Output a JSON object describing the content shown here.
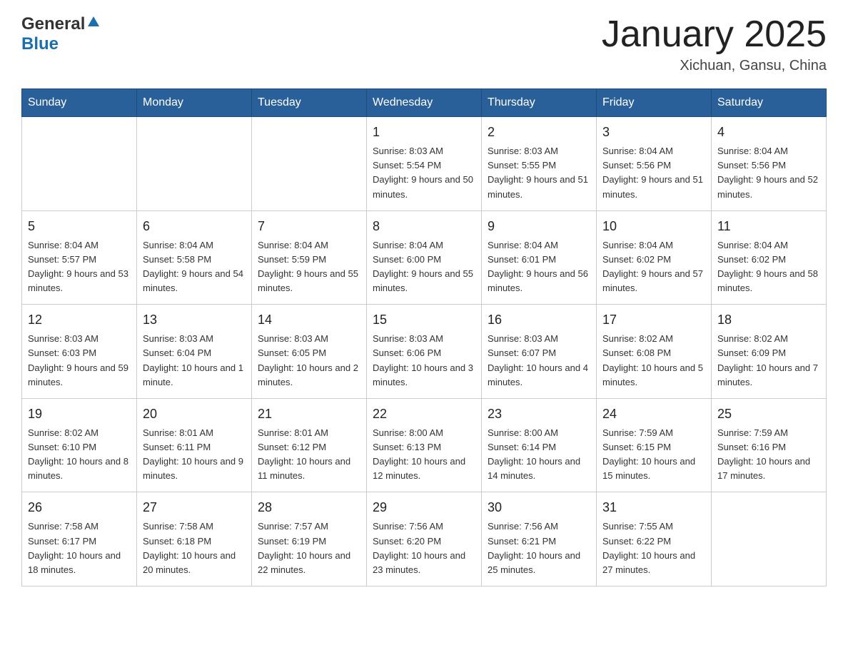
{
  "logo": {
    "general": "General",
    "blue": "Blue"
  },
  "title": {
    "month_year": "January 2025",
    "location": "Xichuan, Gansu, China"
  },
  "headers": [
    "Sunday",
    "Monday",
    "Tuesday",
    "Wednesday",
    "Thursday",
    "Friday",
    "Saturday"
  ],
  "weeks": [
    [
      {
        "day": "",
        "info": ""
      },
      {
        "day": "",
        "info": ""
      },
      {
        "day": "",
        "info": ""
      },
      {
        "day": "1",
        "info": "Sunrise: 8:03 AM\nSunset: 5:54 PM\nDaylight: 9 hours\nand 50 minutes."
      },
      {
        "day": "2",
        "info": "Sunrise: 8:03 AM\nSunset: 5:55 PM\nDaylight: 9 hours\nand 51 minutes."
      },
      {
        "day": "3",
        "info": "Sunrise: 8:04 AM\nSunset: 5:56 PM\nDaylight: 9 hours\nand 51 minutes."
      },
      {
        "day": "4",
        "info": "Sunrise: 8:04 AM\nSunset: 5:56 PM\nDaylight: 9 hours\nand 52 minutes."
      }
    ],
    [
      {
        "day": "5",
        "info": "Sunrise: 8:04 AM\nSunset: 5:57 PM\nDaylight: 9 hours\nand 53 minutes."
      },
      {
        "day": "6",
        "info": "Sunrise: 8:04 AM\nSunset: 5:58 PM\nDaylight: 9 hours\nand 54 minutes."
      },
      {
        "day": "7",
        "info": "Sunrise: 8:04 AM\nSunset: 5:59 PM\nDaylight: 9 hours\nand 55 minutes."
      },
      {
        "day": "8",
        "info": "Sunrise: 8:04 AM\nSunset: 6:00 PM\nDaylight: 9 hours\nand 55 minutes."
      },
      {
        "day": "9",
        "info": "Sunrise: 8:04 AM\nSunset: 6:01 PM\nDaylight: 9 hours\nand 56 minutes."
      },
      {
        "day": "10",
        "info": "Sunrise: 8:04 AM\nSunset: 6:02 PM\nDaylight: 9 hours\nand 57 minutes."
      },
      {
        "day": "11",
        "info": "Sunrise: 8:04 AM\nSunset: 6:02 PM\nDaylight: 9 hours\nand 58 minutes."
      }
    ],
    [
      {
        "day": "12",
        "info": "Sunrise: 8:03 AM\nSunset: 6:03 PM\nDaylight: 9 hours\nand 59 minutes."
      },
      {
        "day": "13",
        "info": "Sunrise: 8:03 AM\nSunset: 6:04 PM\nDaylight: 10 hours\nand 1 minute."
      },
      {
        "day": "14",
        "info": "Sunrise: 8:03 AM\nSunset: 6:05 PM\nDaylight: 10 hours\nand 2 minutes."
      },
      {
        "day": "15",
        "info": "Sunrise: 8:03 AM\nSunset: 6:06 PM\nDaylight: 10 hours\nand 3 minutes."
      },
      {
        "day": "16",
        "info": "Sunrise: 8:03 AM\nSunset: 6:07 PM\nDaylight: 10 hours\nand 4 minutes."
      },
      {
        "day": "17",
        "info": "Sunrise: 8:02 AM\nSunset: 6:08 PM\nDaylight: 10 hours\nand 5 minutes."
      },
      {
        "day": "18",
        "info": "Sunrise: 8:02 AM\nSunset: 6:09 PM\nDaylight: 10 hours\nand 7 minutes."
      }
    ],
    [
      {
        "day": "19",
        "info": "Sunrise: 8:02 AM\nSunset: 6:10 PM\nDaylight: 10 hours\nand 8 minutes."
      },
      {
        "day": "20",
        "info": "Sunrise: 8:01 AM\nSunset: 6:11 PM\nDaylight: 10 hours\nand 9 minutes."
      },
      {
        "day": "21",
        "info": "Sunrise: 8:01 AM\nSunset: 6:12 PM\nDaylight: 10 hours\nand 11 minutes."
      },
      {
        "day": "22",
        "info": "Sunrise: 8:00 AM\nSunset: 6:13 PM\nDaylight: 10 hours\nand 12 minutes."
      },
      {
        "day": "23",
        "info": "Sunrise: 8:00 AM\nSunset: 6:14 PM\nDaylight: 10 hours\nand 14 minutes."
      },
      {
        "day": "24",
        "info": "Sunrise: 7:59 AM\nSunset: 6:15 PM\nDaylight: 10 hours\nand 15 minutes."
      },
      {
        "day": "25",
        "info": "Sunrise: 7:59 AM\nSunset: 6:16 PM\nDaylight: 10 hours\nand 17 minutes."
      }
    ],
    [
      {
        "day": "26",
        "info": "Sunrise: 7:58 AM\nSunset: 6:17 PM\nDaylight: 10 hours\nand 18 minutes."
      },
      {
        "day": "27",
        "info": "Sunrise: 7:58 AM\nSunset: 6:18 PM\nDaylight: 10 hours\nand 20 minutes."
      },
      {
        "day": "28",
        "info": "Sunrise: 7:57 AM\nSunset: 6:19 PM\nDaylight: 10 hours\nand 22 minutes."
      },
      {
        "day": "29",
        "info": "Sunrise: 7:56 AM\nSunset: 6:20 PM\nDaylight: 10 hours\nand 23 minutes."
      },
      {
        "day": "30",
        "info": "Sunrise: 7:56 AM\nSunset: 6:21 PM\nDaylight: 10 hours\nand 25 minutes."
      },
      {
        "day": "31",
        "info": "Sunrise: 7:55 AM\nSunset: 6:22 PM\nDaylight: 10 hours\nand 27 minutes."
      },
      {
        "day": "",
        "info": ""
      }
    ]
  ]
}
